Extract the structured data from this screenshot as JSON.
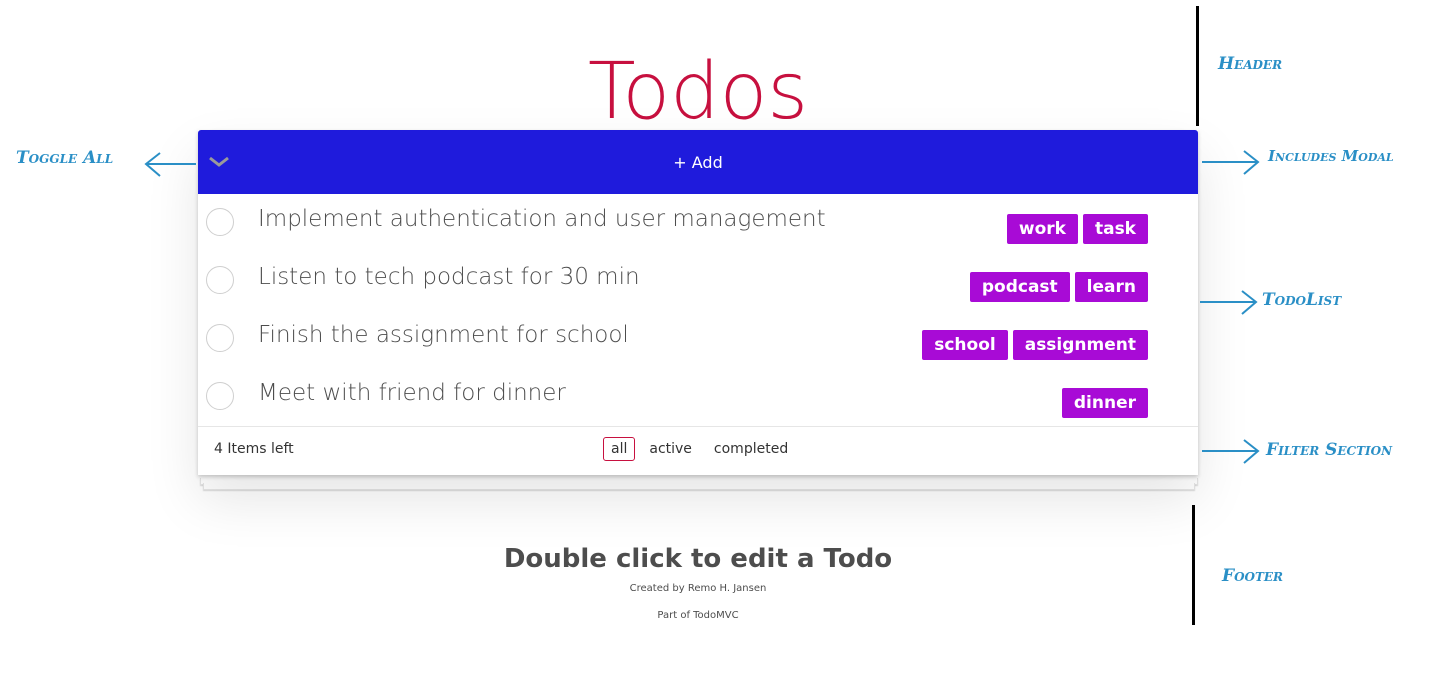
{
  "header": {
    "title": "Todos"
  },
  "add_bar": {
    "toggle_icon": "chevron-down-icon",
    "add_label": "+ Add",
    "background": "#1f1bdc"
  },
  "todos": [
    {
      "label": "Implement authentication and user management",
      "tags": [
        "work",
        "task"
      ],
      "completed": false
    },
    {
      "label": "Listen to tech podcast for 30 min",
      "tags": [
        "podcast",
        "learn"
      ],
      "completed": false
    },
    {
      "label": "Finish the assignment for school",
      "tags": [
        "school",
        "assignment"
      ],
      "completed": false
    },
    {
      "label": "Meet with friend for dinner",
      "tags": [
        "dinner"
      ],
      "completed": false
    }
  ],
  "footer_bar": {
    "count": "4",
    "count_suffix": " Items left",
    "filters": [
      "all",
      "active",
      "completed"
    ],
    "selected_filter": "all"
  },
  "info": {
    "hint": "Double click to edit a Todo",
    "credit": "Created by Remo H. Jansen",
    "part_of": "Part of TodoMVC"
  },
  "annotations": {
    "header": "Header",
    "toggle_all": "Toggle All",
    "includes_modal": "Includes Modal",
    "todolist": "TodoList",
    "filter_section": "Filter Section",
    "footer": "Footer"
  },
  "colors": {
    "title": "#c7103f",
    "tag": "#a80bd6",
    "annotation": "#2a8fc6"
  }
}
